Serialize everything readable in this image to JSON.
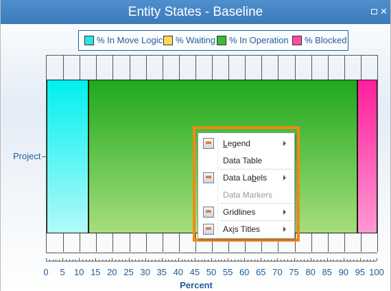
{
  "window": {
    "title": "Entity States - Baseline",
    "controls": {
      "restore": "restore-icon",
      "close": "close-icon",
      "close_glyph": "✕"
    },
    "accent_color": "#3b7ab8"
  },
  "legend": {
    "items": [
      {
        "label": "% In Move Logic",
        "color": "#23e8e6"
      },
      {
        "label": "% Waiting",
        "color": "#ffd75e"
      },
      {
        "label": "% In Operation",
        "color": "#3cb83a"
      },
      {
        "label": "% Blocked",
        "color": "#ff4aa8"
      }
    ]
  },
  "chart_data": {
    "type": "bar",
    "orientation": "horizontal",
    "stacked": true,
    "categories": [
      "Project"
    ],
    "series": [
      {
        "name": "% In Move Logic",
        "values": [
          12.7
        ]
      },
      {
        "name": "% Waiting",
        "values": [
          0
        ]
      },
      {
        "name": "% In Operation",
        "values": [
          81.3
        ]
      },
      {
        "name": "% Blocked",
        "values": [
          6.0
        ]
      }
    ],
    "xlabel": "Percent",
    "ylabel": "",
    "xlim": [
      0,
      100
    ],
    "x_ticks": [
      "0",
      "5",
      "10",
      "15",
      "20",
      "25",
      "30",
      "35",
      "40",
      "45",
      "50",
      "55",
      "60",
      "65",
      "70",
      "75",
      "80",
      "85",
      "90",
      "95",
      "100"
    ],
    "grid": true,
    "legend_position": "top"
  },
  "context_menu": {
    "highlight_color": "#f28a14",
    "items": [
      {
        "label": "Legend",
        "accel_prefix": "",
        "accel": "L",
        "accel_suffix": "egend",
        "icon": "legend-icon",
        "submenu": true,
        "enabled": true
      },
      {
        "label": "Data Table",
        "accel_prefix": "Data Table",
        "accel": "",
        "accel_suffix": "",
        "icon": "",
        "submenu": false,
        "enabled": true
      },
      {
        "label": "Data Labels",
        "accel_prefix": "Data La",
        "accel": "b",
        "accel_suffix": "els",
        "icon": "data-labels-icon",
        "submenu": true,
        "enabled": true
      },
      {
        "label": "Data Markers",
        "accel_prefix": "Data Markers",
        "accel": "",
        "accel_suffix": "",
        "icon": "",
        "submenu": false,
        "enabled": false
      },
      {
        "label": "Gridlines",
        "accel_prefix": "Gridlines",
        "accel": "",
        "accel_suffix": "",
        "icon": "gridlines-icon",
        "submenu": true,
        "enabled": true
      },
      {
        "label": "Axis Titles",
        "accel_prefix": "Ax",
        "accel": "i",
        "accel_suffix": "s Titles",
        "icon": "axis-titles-icon",
        "submenu": true,
        "enabled": true
      }
    ]
  }
}
